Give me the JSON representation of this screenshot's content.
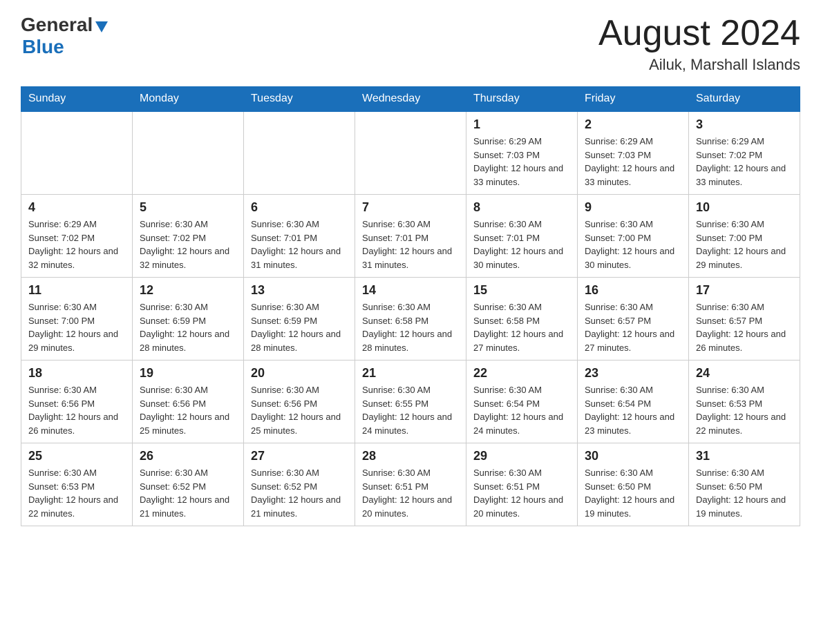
{
  "header": {
    "logo_general": "General",
    "logo_blue": "Blue",
    "title": "August 2024",
    "subtitle": "Ailuk, Marshall Islands"
  },
  "days_of_week": [
    "Sunday",
    "Monday",
    "Tuesday",
    "Wednesday",
    "Thursday",
    "Friday",
    "Saturday"
  ],
  "weeks": [
    [
      {
        "num": "",
        "info": ""
      },
      {
        "num": "",
        "info": ""
      },
      {
        "num": "",
        "info": ""
      },
      {
        "num": "",
        "info": ""
      },
      {
        "num": "1",
        "info": "Sunrise: 6:29 AM\nSunset: 7:03 PM\nDaylight: 12 hours and 33 minutes."
      },
      {
        "num": "2",
        "info": "Sunrise: 6:29 AM\nSunset: 7:03 PM\nDaylight: 12 hours and 33 minutes."
      },
      {
        "num": "3",
        "info": "Sunrise: 6:29 AM\nSunset: 7:02 PM\nDaylight: 12 hours and 33 minutes."
      }
    ],
    [
      {
        "num": "4",
        "info": "Sunrise: 6:29 AM\nSunset: 7:02 PM\nDaylight: 12 hours and 32 minutes."
      },
      {
        "num": "5",
        "info": "Sunrise: 6:30 AM\nSunset: 7:02 PM\nDaylight: 12 hours and 32 minutes."
      },
      {
        "num": "6",
        "info": "Sunrise: 6:30 AM\nSunset: 7:01 PM\nDaylight: 12 hours and 31 minutes."
      },
      {
        "num": "7",
        "info": "Sunrise: 6:30 AM\nSunset: 7:01 PM\nDaylight: 12 hours and 31 minutes."
      },
      {
        "num": "8",
        "info": "Sunrise: 6:30 AM\nSunset: 7:01 PM\nDaylight: 12 hours and 30 minutes."
      },
      {
        "num": "9",
        "info": "Sunrise: 6:30 AM\nSunset: 7:00 PM\nDaylight: 12 hours and 30 minutes."
      },
      {
        "num": "10",
        "info": "Sunrise: 6:30 AM\nSunset: 7:00 PM\nDaylight: 12 hours and 29 minutes."
      }
    ],
    [
      {
        "num": "11",
        "info": "Sunrise: 6:30 AM\nSunset: 7:00 PM\nDaylight: 12 hours and 29 minutes."
      },
      {
        "num": "12",
        "info": "Sunrise: 6:30 AM\nSunset: 6:59 PM\nDaylight: 12 hours and 28 minutes."
      },
      {
        "num": "13",
        "info": "Sunrise: 6:30 AM\nSunset: 6:59 PM\nDaylight: 12 hours and 28 minutes."
      },
      {
        "num": "14",
        "info": "Sunrise: 6:30 AM\nSunset: 6:58 PM\nDaylight: 12 hours and 28 minutes."
      },
      {
        "num": "15",
        "info": "Sunrise: 6:30 AM\nSunset: 6:58 PM\nDaylight: 12 hours and 27 minutes."
      },
      {
        "num": "16",
        "info": "Sunrise: 6:30 AM\nSunset: 6:57 PM\nDaylight: 12 hours and 27 minutes."
      },
      {
        "num": "17",
        "info": "Sunrise: 6:30 AM\nSunset: 6:57 PM\nDaylight: 12 hours and 26 minutes."
      }
    ],
    [
      {
        "num": "18",
        "info": "Sunrise: 6:30 AM\nSunset: 6:56 PM\nDaylight: 12 hours and 26 minutes."
      },
      {
        "num": "19",
        "info": "Sunrise: 6:30 AM\nSunset: 6:56 PM\nDaylight: 12 hours and 25 minutes."
      },
      {
        "num": "20",
        "info": "Sunrise: 6:30 AM\nSunset: 6:56 PM\nDaylight: 12 hours and 25 minutes."
      },
      {
        "num": "21",
        "info": "Sunrise: 6:30 AM\nSunset: 6:55 PM\nDaylight: 12 hours and 24 minutes."
      },
      {
        "num": "22",
        "info": "Sunrise: 6:30 AM\nSunset: 6:54 PM\nDaylight: 12 hours and 24 minutes."
      },
      {
        "num": "23",
        "info": "Sunrise: 6:30 AM\nSunset: 6:54 PM\nDaylight: 12 hours and 23 minutes."
      },
      {
        "num": "24",
        "info": "Sunrise: 6:30 AM\nSunset: 6:53 PM\nDaylight: 12 hours and 22 minutes."
      }
    ],
    [
      {
        "num": "25",
        "info": "Sunrise: 6:30 AM\nSunset: 6:53 PM\nDaylight: 12 hours and 22 minutes."
      },
      {
        "num": "26",
        "info": "Sunrise: 6:30 AM\nSunset: 6:52 PM\nDaylight: 12 hours and 21 minutes."
      },
      {
        "num": "27",
        "info": "Sunrise: 6:30 AM\nSunset: 6:52 PM\nDaylight: 12 hours and 21 minutes."
      },
      {
        "num": "28",
        "info": "Sunrise: 6:30 AM\nSunset: 6:51 PM\nDaylight: 12 hours and 20 minutes."
      },
      {
        "num": "29",
        "info": "Sunrise: 6:30 AM\nSunset: 6:51 PM\nDaylight: 12 hours and 20 minutes."
      },
      {
        "num": "30",
        "info": "Sunrise: 6:30 AM\nSunset: 6:50 PM\nDaylight: 12 hours and 19 minutes."
      },
      {
        "num": "31",
        "info": "Sunrise: 6:30 AM\nSunset: 6:50 PM\nDaylight: 12 hours and 19 minutes."
      }
    ]
  ]
}
